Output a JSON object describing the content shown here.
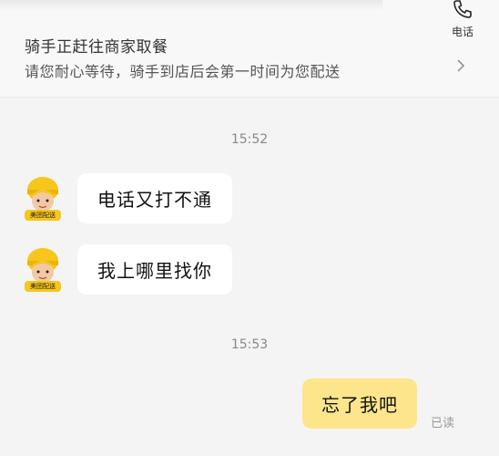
{
  "status": {
    "title": "骑手正赶往商家取餐",
    "subtitle": "请您耐心等待，骑手到店后会第一时间为您配送",
    "phone_label": "电话"
  },
  "rider": {
    "badge": "美团配送"
  },
  "messages": {
    "time1": "15:52",
    "m1": "电话又打不通",
    "m2": "我上哪里找你",
    "time2": "15:53",
    "m3": "忘了我吧",
    "read_status": "已读"
  },
  "icons": {
    "phone": "phone-icon",
    "chevron": "chevron-right-icon"
  },
  "colors": {
    "self_bubble": "#fde58c",
    "helmet": "#f7c61b"
  }
}
